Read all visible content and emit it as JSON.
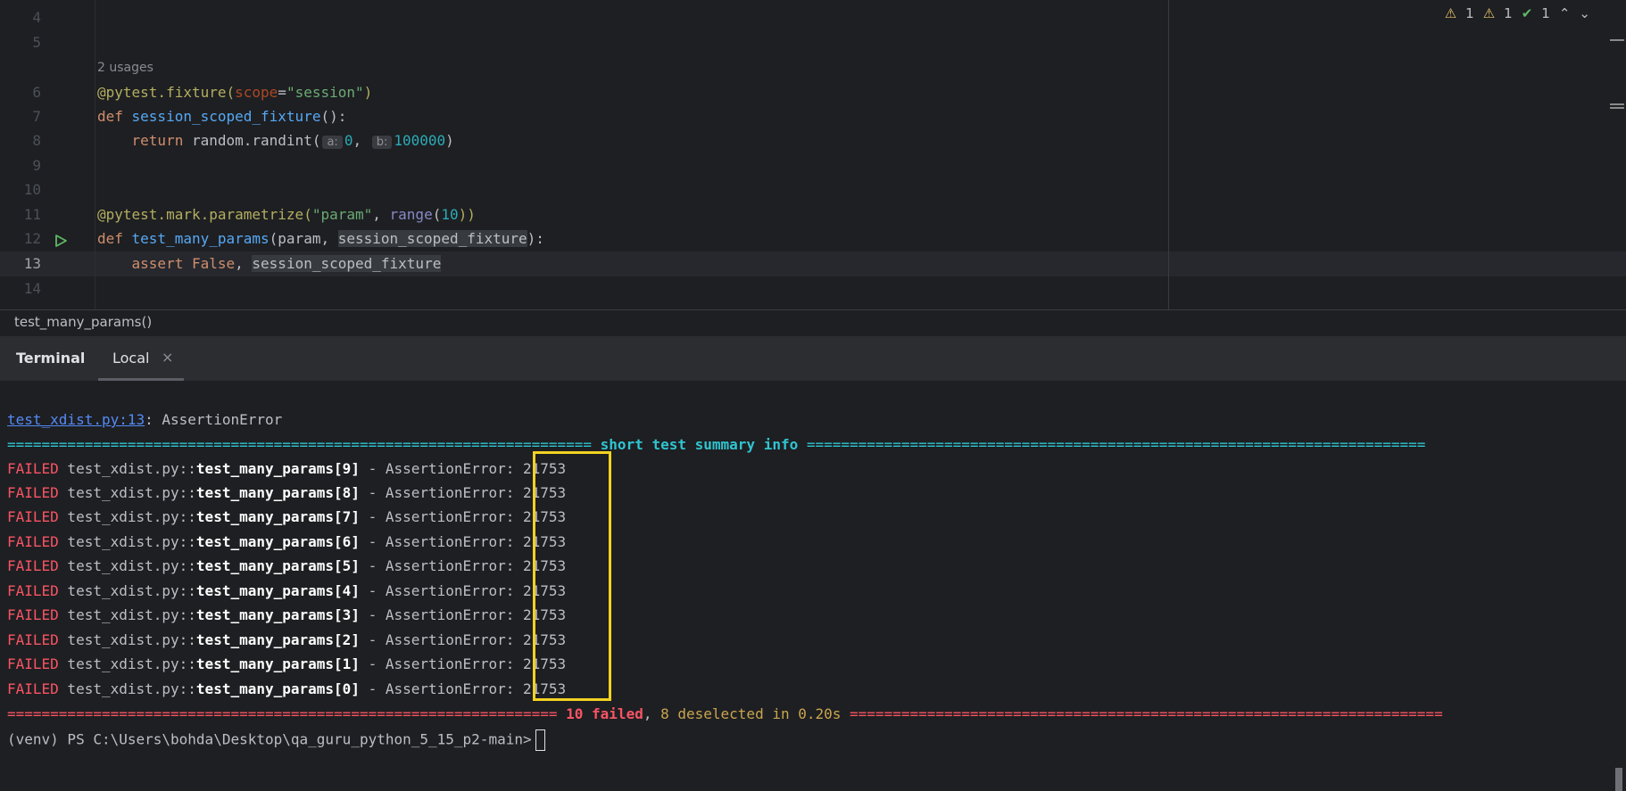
{
  "editor": {
    "line_numbers": [
      "4",
      "5",
      "6",
      "7",
      "8",
      "9",
      "10",
      "11",
      "12",
      "13",
      "14"
    ],
    "current_line": "13",
    "usages_hint": "2 usages",
    "code": {
      "l6": {
        "dec": "@pytest.fixture(",
        "param": "scope",
        "eq": "=",
        "str": "\"session\"",
        "close": ")"
      },
      "l7": {
        "kw": "def ",
        "fn": "session_scoped_fixture",
        "rest": "():"
      },
      "l8": {
        "indent": "    ",
        "kw": "return ",
        "rest": "random.randint(",
        "hint_a": "a:",
        "num_a": "0",
        ",": ", ",
        "hint_b": "b:",
        "num_b": "100000",
        "close": ")"
      },
      "l11": {
        "dec": "@pytest.mark.parametrize(",
        "str": "\"param\"",
        "comma": ", ",
        "builtin": "range",
        "open": "(",
        "num": "10",
        "close": "))"
      },
      "l12": {
        "kw": "def ",
        "fn": "test_many_params",
        "rest": "(param, ",
        "hl": "session_scoped_fixture",
        "close": "):"
      },
      "l13": {
        "indent": "    ",
        "kw": "assert ",
        "kw2": "False",
        ",": ", ",
        "hl": "session_scoped_fixture"
      }
    },
    "inspections": {
      "warn1": "1",
      "warn2": "1",
      "ok": "1"
    }
  },
  "breadcrumb": "test_many_params()",
  "tool_window": {
    "title": "Terminal",
    "tab_label": "Local",
    "tab_close": "×"
  },
  "terminal": {
    "error_link": "test_xdist.py:13",
    "error_text": ": AssertionError",
    "summary_sep_left": "====================================================================",
    "summary_title": " short test summary info ",
    "summary_sep_right": "========================================================================",
    "failures": [
      {
        "status": "FAILED",
        "prefix": " test_xdist.py::",
        "test": "test_many_params[9]",
        "suffix": " - AssertionError: 21753"
      },
      {
        "status": "FAILED",
        "prefix": " test_xdist.py::",
        "test": "test_many_params[8]",
        "suffix": " - AssertionError: 21753"
      },
      {
        "status": "FAILED",
        "prefix": " test_xdist.py::",
        "test": "test_many_params[7]",
        "suffix": " - AssertionError: 21753"
      },
      {
        "status": "FAILED",
        "prefix": " test_xdist.py::",
        "test": "test_many_params[6]",
        "suffix": " - AssertionError: 21753"
      },
      {
        "status": "FAILED",
        "prefix": " test_xdist.py::",
        "test": "test_many_params[5]",
        "suffix": " - AssertionError: 21753"
      },
      {
        "status": "FAILED",
        "prefix": " test_xdist.py::",
        "test": "test_many_params[4]",
        "suffix": " - AssertionError: 21753"
      },
      {
        "status": "FAILED",
        "prefix": " test_xdist.py::",
        "test": "test_many_params[3]",
        "suffix": " - AssertionError: 21753"
      },
      {
        "status": "FAILED",
        "prefix": " test_xdist.py::",
        "test": "test_many_params[2]",
        "suffix": " - AssertionError: 21753"
      },
      {
        "status": "FAILED",
        "prefix": " test_xdist.py::",
        "test": "test_many_params[1]",
        "suffix": " - AssertionError: 21753"
      },
      {
        "status": "FAILED",
        "prefix": " test_xdist.py::",
        "test": "test_many_params[0]",
        "suffix": " - AssertionError: 21753"
      }
    ],
    "result_sep_left": "================================================================",
    "result_failed": " 10 failed",
    "result_comma": ",",
    "result_rest": " 8 deselected in 0.20s ",
    "result_sep_right": "=====================================================================",
    "prompt": "(venv) PS C:\\Users\\bohda\\Desktop\\qa_guru_python_5_15_p2-main>"
  },
  "colors": {
    "annotation_box": "#f2d222",
    "failed_red": "#f75464",
    "summary_cyan": "#2fc5d1"
  }
}
